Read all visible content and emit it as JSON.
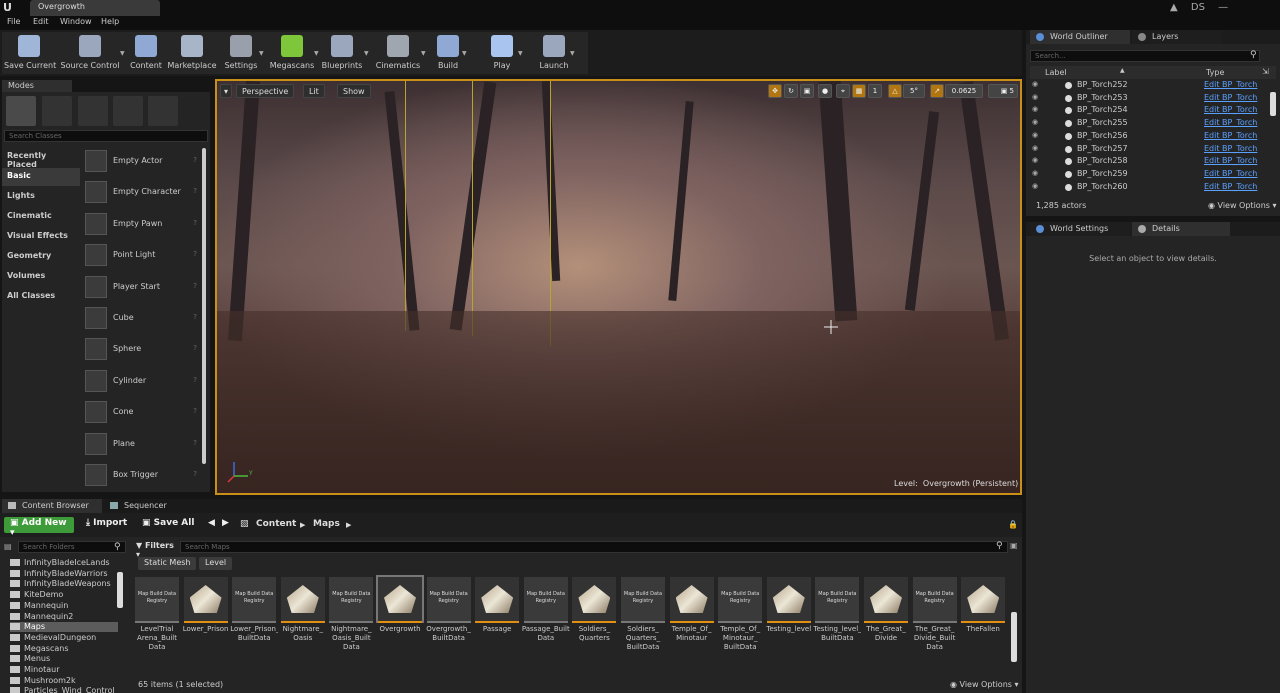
{
  "window": {
    "tab_title": "Overgrowth",
    "user": "DS"
  },
  "menu": [
    "File",
    "Edit",
    "Window",
    "Help"
  ],
  "toolbar": [
    {
      "label": "Save Current",
      "icon": "save-icon",
      "color": "#9fb6d8"
    },
    {
      "label": "Source Control",
      "icon": "source-control-icon",
      "color": "#9aa7bd"
    },
    {
      "label": "Content",
      "icon": "content-icon",
      "color": "#8fa8d4"
    },
    {
      "label": "Marketplace",
      "icon": "marketplace-icon",
      "color": "#a8b4c8"
    },
    {
      "label": "Settings",
      "icon": "settings-icon",
      "color": "#9aa0ab"
    },
    {
      "label": "Megascans",
      "icon": "megascans-icon",
      "color": "#7ec73a"
    },
    {
      "label": "Blueprints",
      "icon": "blueprints-icon",
      "color": "#9aa7bd"
    },
    {
      "label": "Cinematics",
      "icon": "cinematics-icon",
      "color": "#a0a6b0"
    },
    {
      "label": "Build",
      "icon": "build-icon",
      "color": "#8fa8d4"
    },
    {
      "label": "Play",
      "icon": "play-icon",
      "color": "#a9c4ef"
    },
    {
      "label": "Launch",
      "icon": "launch-icon",
      "color": "#9aa7bd"
    }
  ],
  "modes": {
    "tab": "Modes",
    "search_placeholder": "Search Classes",
    "categories": [
      "Recently Placed",
      "Basic",
      "Lights",
      "Cinematic",
      "Visual Effects",
      "Geometry",
      "Volumes",
      "All Classes"
    ],
    "active_category": "Basic",
    "items": [
      "Empty Actor",
      "Empty Character",
      "Empty Pawn",
      "Point Light",
      "Player Start",
      "Cube",
      "Sphere",
      "Cylinder",
      "Cone",
      "Plane",
      "Box Trigger"
    ]
  },
  "viewport": {
    "perspective": "Perspective",
    "lit": "Lit",
    "show": "Show",
    "grid_snap": "1",
    "rotation_snap": "5°",
    "scale_snap": "0.0625",
    "camera_speed": "5",
    "level_prefix": "Level:",
    "level_name": "Overgrowth (Persistent)"
  },
  "outliner": {
    "tab": "World Outliner",
    "tab2": "Layers",
    "search_placeholder": "Search...",
    "col_label": "Label",
    "col_type": "Type",
    "rows": [
      {
        "label": "BP_Torch252",
        "type": "Edit BP_Torch"
      },
      {
        "label": "BP_Torch253",
        "type": "Edit BP_Torch"
      },
      {
        "label": "BP_Torch254",
        "type": "Edit BP_Torch"
      },
      {
        "label": "BP_Torch255",
        "type": "Edit BP_Torch"
      },
      {
        "label": "BP_Torch256",
        "type": "Edit BP_Torch"
      },
      {
        "label": "BP_Torch257",
        "type": "Edit BP_Torch"
      },
      {
        "label": "BP_Torch258",
        "type": "Edit BP_Torch"
      },
      {
        "label": "BP_Torch259",
        "type": "Edit BP_Torch"
      },
      {
        "label": "BP_Torch260",
        "type": "Edit BP_Torch"
      }
    ],
    "count": "1,285 actors",
    "view_options": "View Options"
  },
  "details": {
    "tab": "World Settings",
    "tab2": "Details",
    "message": "Select an object to view details."
  },
  "content_browser": {
    "tab": "Content Browser",
    "tab2": "Sequencer",
    "add_new": "Add New",
    "import": "Import",
    "save_all": "Save All",
    "path": [
      "Content",
      "Maps"
    ],
    "folder_search_placeholder": "Search Folders",
    "folders": [
      "InfinityBladeIceLands",
      "InfinityBladeWarriors",
      "InfinityBladeWeapons",
      "KiteDemo",
      "Mannequin",
      "Mannequin2",
      "Maps",
      "MedievalDungeon",
      "Megascans",
      "Menus",
      "Minotaur",
      "Mushroom2k",
      "Particles_Wind_Control"
    ],
    "selected_folder": "Maps",
    "filters": "Filters",
    "search_placeholder": "Search Maps",
    "chips": [
      "Static Mesh",
      "Level"
    ],
    "build_data_label": "Map Build Data Registry",
    "assets": [
      {
        "name": "LevelTrial Arena_Built Data",
        "kind": "build"
      },
      {
        "name": "Lower_Prison",
        "kind": "map"
      },
      {
        "name": "Lower_Prison_ BuiltData",
        "kind": "build"
      },
      {
        "name": "Nightmare_ Oasis",
        "kind": "map"
      },
      {
        "name": "Nightmare_ Oasis_Built Data",
        "kind": "build"
      },
      {
        "name": "Overgrowth",
        "kind": "map"
      },
      {
        "name": "Overgrowth_ BuiltData",
        "kind": "build"
      },
      {
        "name": "Passage",
        "kind": "map"
      },
      {
        "name": "Passage_Built Data",
        "kind": "build"
      },
      {
        "name": "Soldiers_ Quarters",
        "kind": "map"
      },
      {
        "name": "Soldiers_ Quarters_ BuiltData",
        "kind": "build"
      },
      {
        "name": "Temple_Of_ Minotaur",
        "kind": "map"
      },
      {
        "name": "Temple_Of_ Minotaur_ BuiltData",
        "kind": "build"
      },
      {
        "name": "Testing_level",
        "kind": "map"
      },
      {
        "name": "Testing_level_ BuiltData",
        "kind": "build"
      },
      {
        "name": "The_Great_ Divide",
        "kind": "map"
      },
      {
        "name": "The_Great_ Divide_Built Data",
        "kind": "build"
      },
      {
        "name": "TheFallen",
        "kind": "map"
      }
    ],
    "selected_asset": "Overgrowth",
    "items_count": "65 items (1 selected)",
    "view_options": "View Options"
  }
}
